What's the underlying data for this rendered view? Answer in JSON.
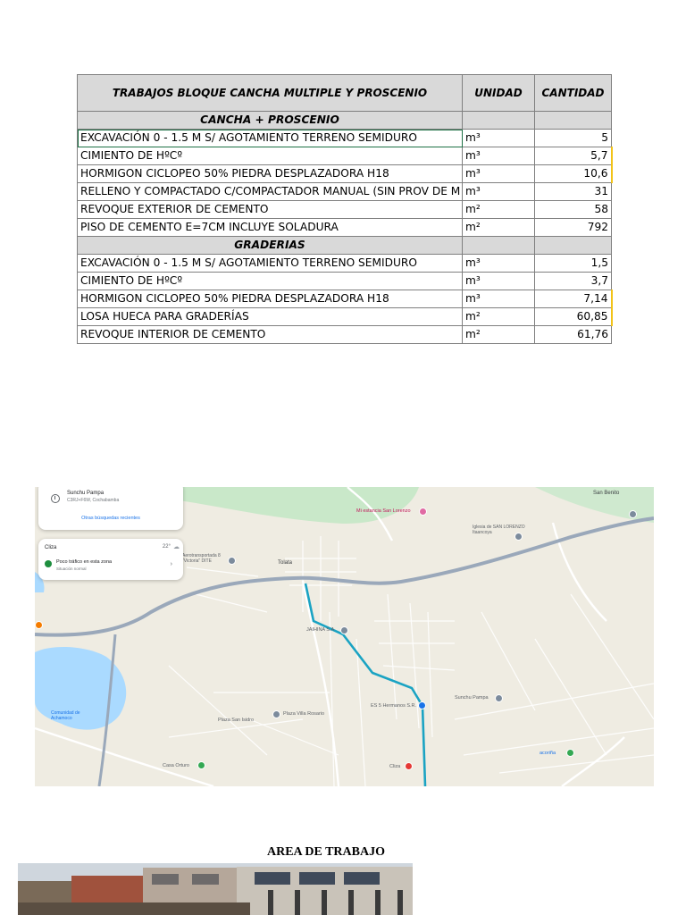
{
  "table": {
    "header": {
      "description": "TRABAJOS BLOQUE CANCHA MULTIPLE Y PROSCENIO",
      "unit": "UNIDAD",
      "quantity": "CANTIDAD"
    },
    "sections": [
      {
        "title": "CANCHA + PROSCENIO",
        "rows": [
          {
            "description": "EXCAVACIÓN 0 - 1.5 M S/ AGOTAMIENTO TERRENO SEMIDURO",
            "unit": "m³",
            "quantity": "5"
          },
          {
            "description": "CIMIENTO DE HºCº",
            "unit": "m³",
            "quantity": "5,7"
          },
          {
            "description": "HORMIGON CICLOPEO 50% PIEDRA DESPLAZADORA H18",
            "unit": "m³",
            "quantity": "10,6"
          },
          {
            "description": "RELLENO Y COMPACTADO C/COMPACTADOR MANUAL (SIN PROV DE M",
            "unit": "m³",
            "quantity": "31"
          },
          {
            "description": "REVOQUE EXTERIOR DE CEMENTO",
            "unit": "m²",
            "quantity": "58"
          },
          {
            "description": "PISO DE CEMENTO E=7CM INCLUYE SOLADURA",
            "unit": "m²",
            "quantity": "792"
          }
        ]
      },
      {
        "title": "GRADERIAS",
        "rows": [
          {
            "description": "EXCAVACIÓN 0 - 1.5 M S/ AGOTAMIENTO TERRENO SEMIDURO",
            "unit": "m³",
            "quantity": "1,5"
          },
          {
            "description": "CIMIENTO DE HºCº",
            "unit": "m³",
            "quantity": "3,7"
          },
          {
            "description": "HORMIGON CICLOPEO 50% PIEDRA DESPLAZADORA H18",
            "unit": "m³",
            "quantity": "7,14"
          },
          {
            "description": "LOSA HUECA PARA GRADERÍAS",
            "unit": "m²",
            "quantity": "60,85"
          },
          {
            "description": "REVOQUE INTERIOR DE CEMENTO",
            "unit": "m²",
            "quantity": "61,76"
          }
        ]
      }
    ]
  },
  "map": {
    "card_recent": {
      "place": "Sunchu Pampa",
      "address": "C3RJ+F6W, Cochabamba",
      "link": "Otras búsquedas recientes"
    },
    "card_traffic": {
      "place": "Cliza",
      "temperature": "22°",
      "status": "Poco tráfico en esta zona",
      "substatus": "Situación normal"
    },
    "labels": {
      "san_benito": "San Benito",
      "mi_estancia": "Mi estancia San Lorenzo",
      "iglesia": "Iglesia de SAN LORENZO Itaancoya",
      "aerotransportada": "Aerotransportada 8 \"Victoria\" DITE",
      "tolata": "Tolata",
      "jaihina": "JAIHINA S.A",
      "sunchu_pampa": "Sunchu Pampa",
      "es5": "ES 5 Hermanos S.R.",
      "comunidad": "Comunidad de Achamoco",
      "plaza_san_isidro": "Plaza San Isidro",
      "plaza_villa_rosario": "Plaza Villa Rosario",
      "casa_ortuno": "Casa Orturo",
      "cliza": "Cliza",
      "acoriña": "acoriña"
    }
  },
  "photo_section": {
    "title": "AREA DE TRABAJO"
  }
}
